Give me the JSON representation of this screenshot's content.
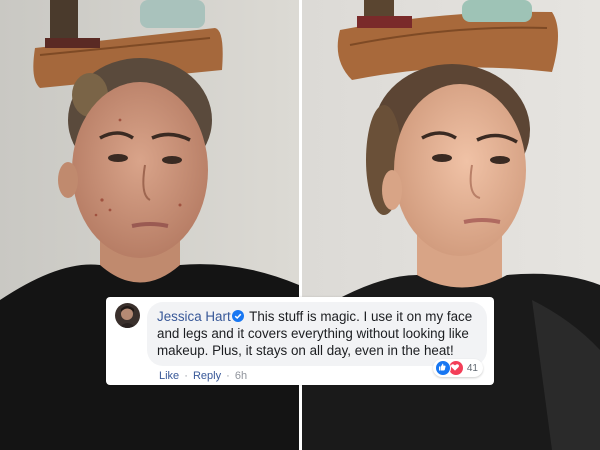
{
  "photos": {
    "left_alt": "before photo",
    "right_alt": "after photo"
  },
  "comment": {
    "author": "Jessica Hart",
    "text": "This stuff is magic. I use it on my face and legs and it covers everything without looking like makeup. Plus, it stays on all day, even in the heat!",
    "reaction_count": "41",
    "actions": {
      "like": "Like",
      "reply": "Reply",
      "separator": "·",
      "time": "6h"
    },
    "icons": {
      "verified": "verified-badge-icon",
      "like": "thumbs-up-icon",
      "love": "heart-icon"
    }
  },
  "colors": {
    "link": "#385898",
    "bubble": "#f2f3f5",
    "like_blue": "#1877f2",
    "love_red": "#f33e58"
  }
}
